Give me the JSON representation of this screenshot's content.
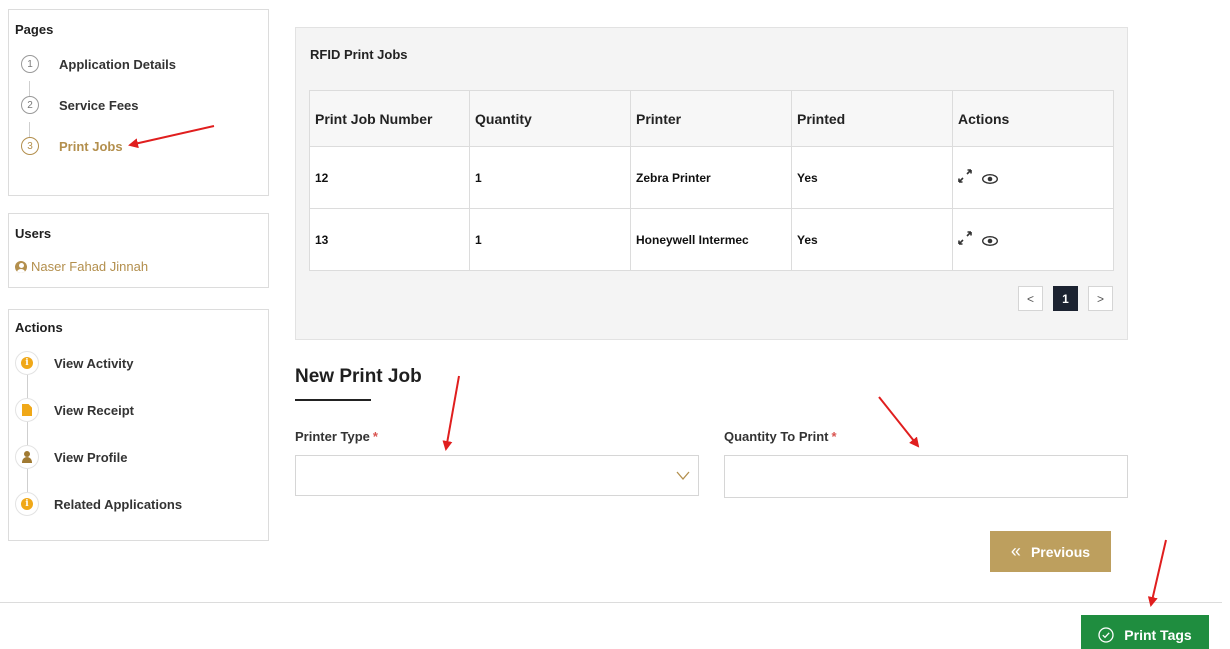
{
  "sidebar": {
    "pages": {
      "title": "Pages",
      "steps": [
        {
          "num": "1",
          "label": "Application Details"
        },
        {
          "num": "2",
          "label": "Service Fees"
        },
        {
          "num": "3",
          "label": "Print Jobs",
          "active": true
        }
      ]
    },
    "users": {
      "title": "Users",
      "name": "Naser Fahad Jinnah"
    },
    "actions": {
      "title": "Actions",
      "items": [
        {
          "label": "View Activity",
          "icon": "info-icon"
        },
        {
          "label": "View Receipt",
          "icon": "document-icon"
        },
        {
          "label": "View Profile",
          "icon": "person-icon"
        },
        {
          "label": "Related Applications",
          "icon": "info-icon"
        }
      ]
    }
  },
  "rfid": {
    "title": "RFID Print Jobs",
    "columns": [
      "Print Job Number",
      "Quantity",
      "Printer",
      "Printed",
      "Actions"
    ],
    "rows": [
      {
        "number": "12",
        "quantity": "1",
        "printer": "Zebra Printer",
        "printed": "Yes"
      },
      {
        "number": "13",
        "quantity": "1",
        "printer": "Honeywell Intermec",
        "printed": "Yes"
      }
    ],
    "pagination": {
      "prev": "<",
      "current": "1",
      "next": ">"
    }
  },
  "new_job": {
    "title": "New Print Job",
    "printer_label": "Printer Type",
    "quantity_label": "Quantity To Print",
    "required_mark": "*",
    "printer_value": "",
    "quantity_value": ""
  },
  "buttons": {
    "previous": "Previous",
    "previous_icon": "«",
    "print_tags": "Print Tags"
  },
  "colors": {
    "accent_gold": "#b38f4d",
    "button_gold": "#bd9f5e",
    "print_green": "#1f8d3f",
    "annotation_red": "#e01e1e"
  }
}
